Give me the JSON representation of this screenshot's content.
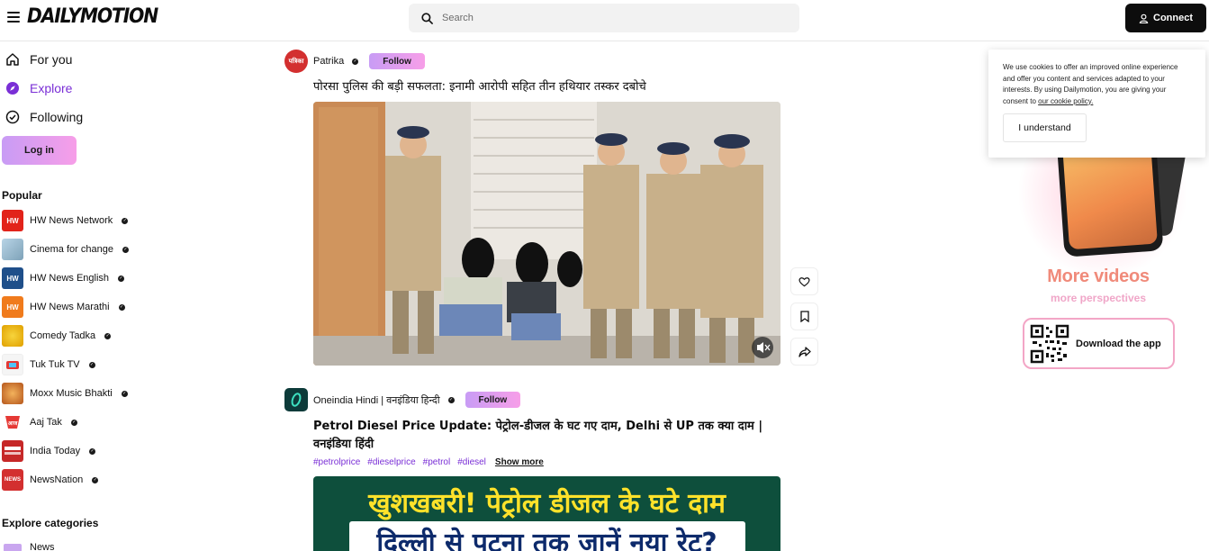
{
  "header": {
    "logo": "DAILYMOTION",
    "search_placeholder": "Search",
    "connect_label": "Connect"
  },
  "sidebar": {
    "nav": [
      {
        "label": "For you",
        "icon": "home-icon"
      },
      {
        "label": "Explore",
        "icon": "compass-icon",
        "active": true
      },
      {
        "label": "Following",
        "icon": "check-circle-icon"
      }
    ],
    "login_label": "Log in",
    "popular_title": "Popular",
    "popular": [
      {
        "name": "HW News Network",
        "badge": "HW",
        "color": "#e2231a"
      },
      {
        "name": "Cinema for change",
        "badge": "",
        "color": "#8fb6d0"
      },
      {
        "name": "HW News English",
        "badge": "HW",
        "color": "#1f4f8a"
      },
      {
        "name": "HW News Marathi",
        "badge": "HW",
        "color": "#f07b1c"
      },
      {
        "name": "Comedy Tadka",
        "badge": "",
        "color": "#f2c21a"
      },
      {
        "name": "Tuk Tuk TV",
        "badge": "",
        "color": "#f3f3f3"
      },
      {
        "name": "Moxx Music Bhakti",
        "badge": "",
        "color": "#d9822b"
      },
      {
        "name": "Aaj Tak",
        "badge": "",
        "color": "#e53935"
      },
      {
        "name": "India Today",
        "badge": "",
        "color": "#c62828"
      },
      {
        "name": "NewsNation",
        "badge": "NEWS",
        "color": "#d32f2f"
      }
    ],
    "explore_title": "Explore categories",
    "categories": [
      {
        "name": "News"
      }
    ]
  },
  "feed": [
    {
      "channel": "Patrika",
      "avatar_text": "पत्रिका",
      "avatar_color": "#d32f2f",
      "follow_label": "Follow",
      "title": "पोरसा पुलिस की बड़ी सफलता: इनामी आरोपी सहित तीन हथियार तस्कर दबोचे"
    },
    {
      "channel": "Oneindia Hindi | वनइंडिया हिन्दी",
      "avatar_text": "O",
      "avatar_color": "#0d3b3a",
      "follow_label": "Follow",
      "title_line1": "Petrol Diesel Price Update: पेट्रोल-डीजल के घट गए दाम, Delhi से UP तक क्या दाम |",
      "title_line2": "वनइंडिया हिंदी",
      "tags": [
        "#petrolprice",
        "#dieselprice",
        "#petrol",
        "#diesel"
      ],
      "show_more": "Show more",
      "thumb_line1": "खुशखबरी! पेट्रोल डीजल के घटे दाम",
      "thumb_line2": "दिल्ली से पटना तक जानें नया रेट?"
    }
  ],
  "promo": {
    "title": "More videos",
    "subtitle": "more perspectives",
    "download_label": "Download the app"
  },
  "cookie": {
    "text": "We use cookies to offer an improved online experience and offer you content and services adapted to your interests. By using Dailymotion, you are giving your consent to",
    "link": "our cookie policy.",
    "button": "I understand"
  }
}
